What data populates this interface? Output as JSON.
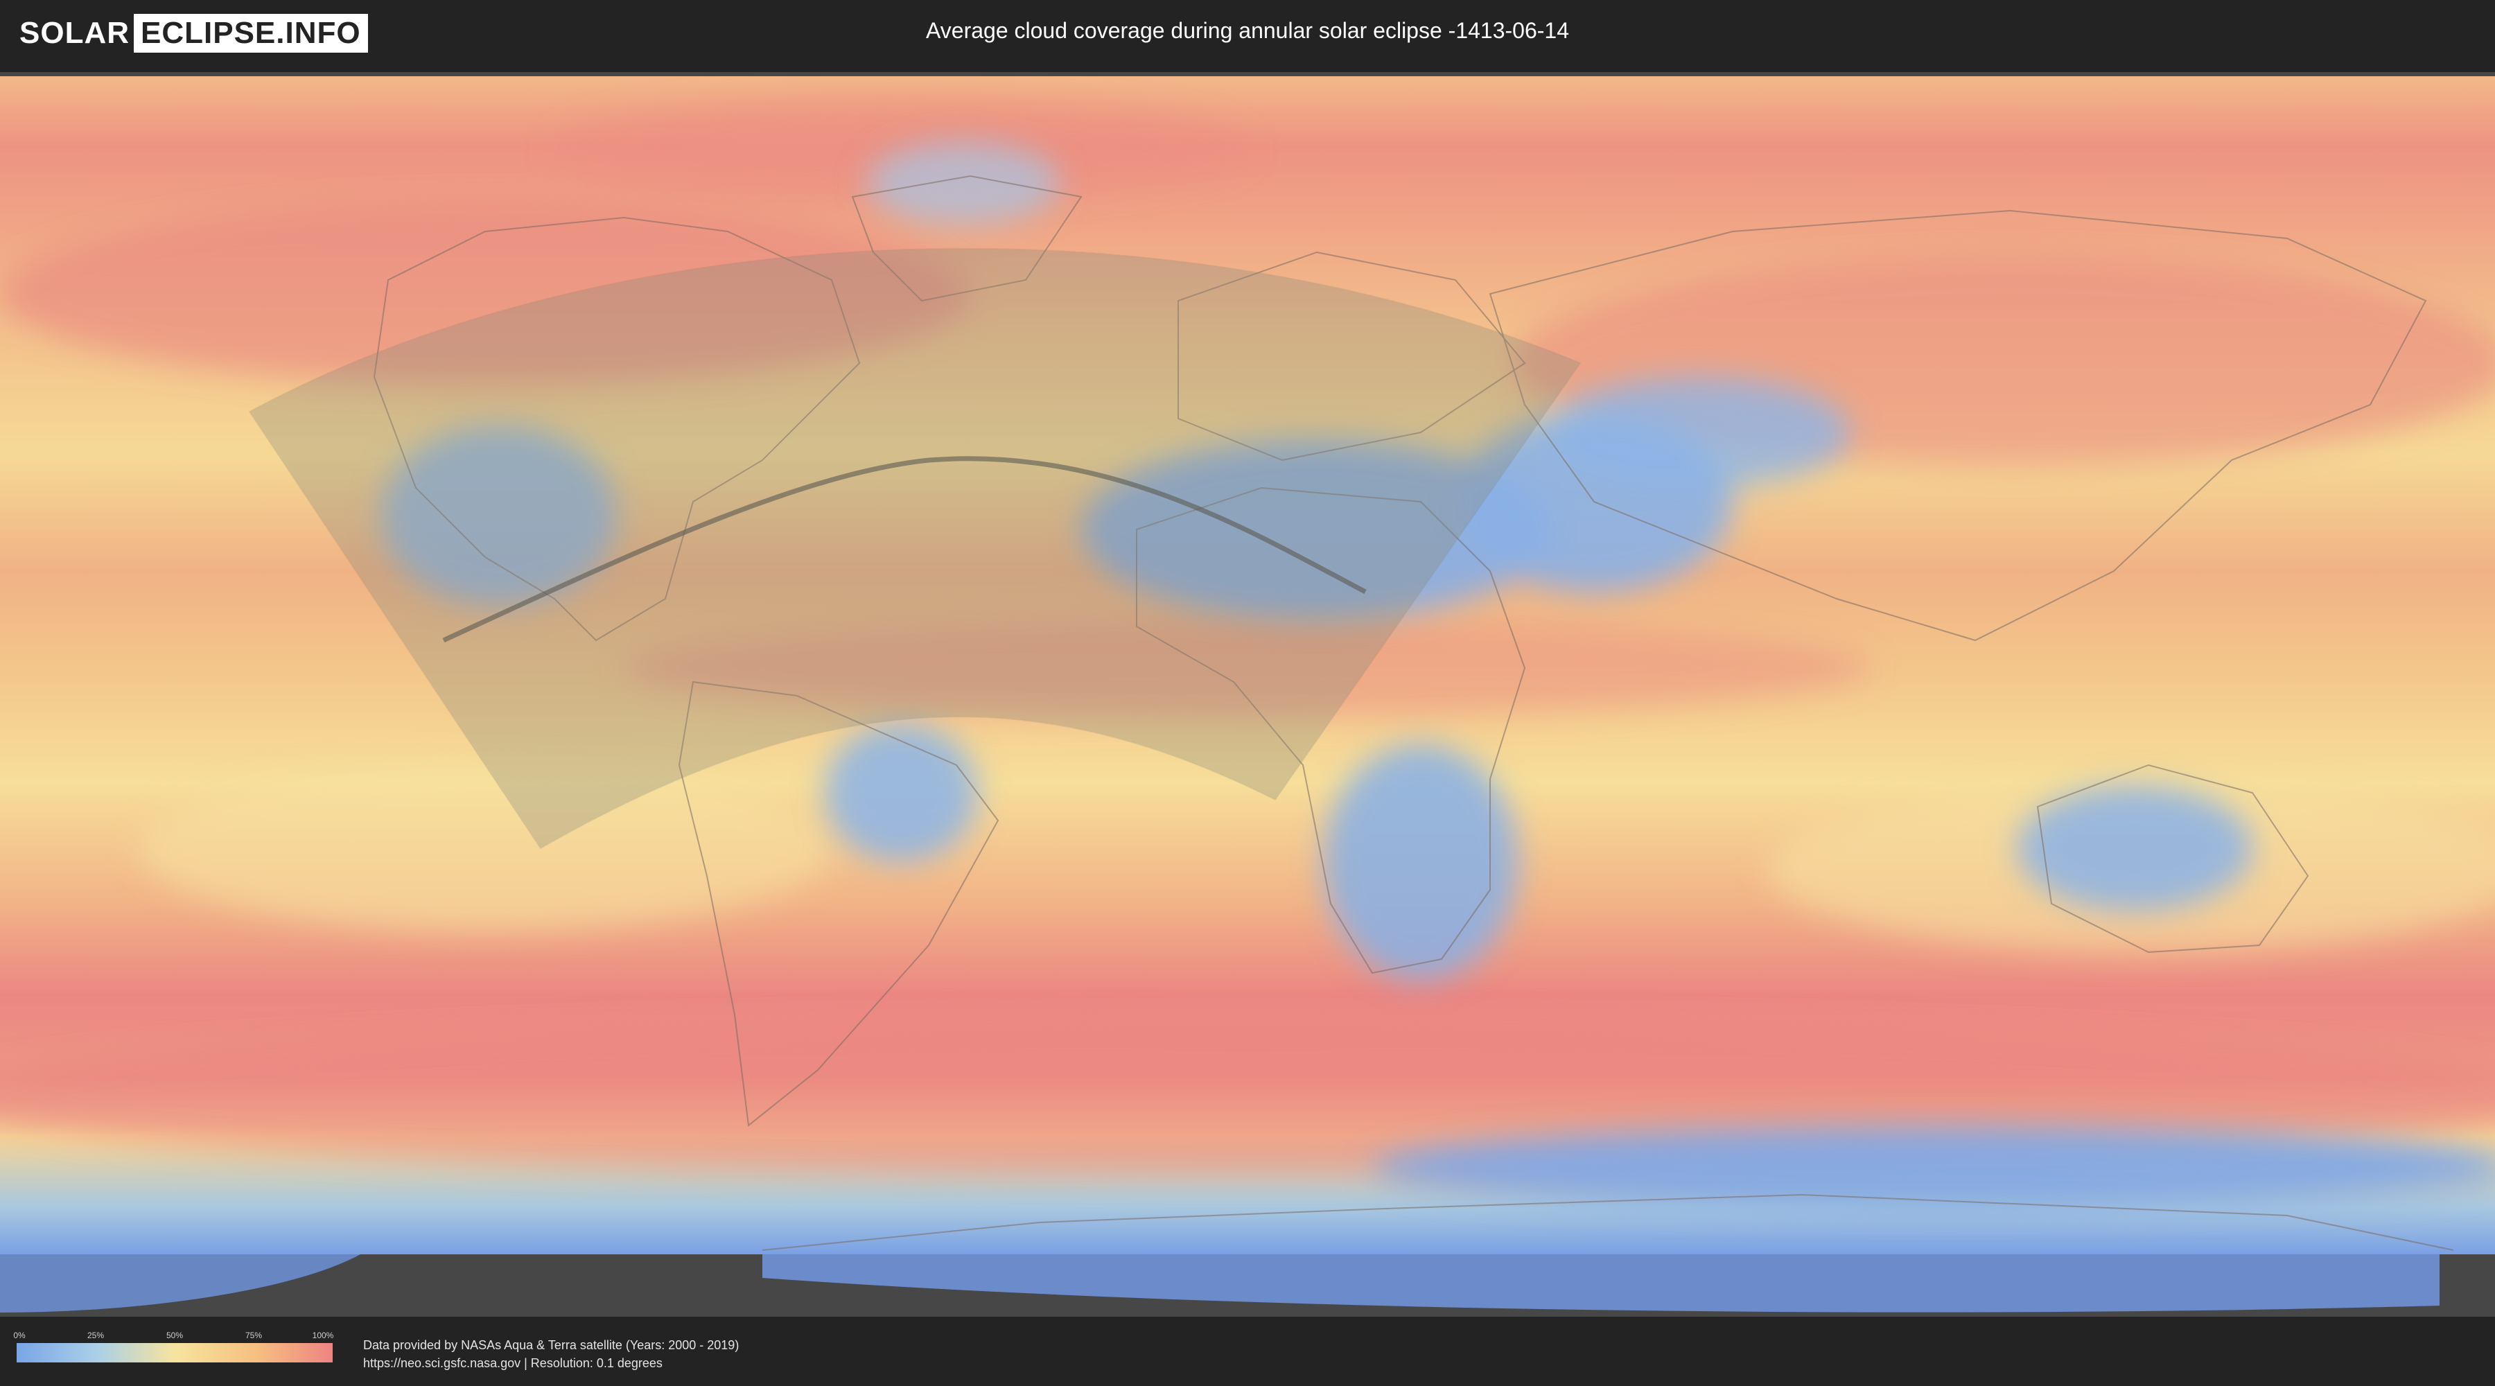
{
  "header": {
    "logo_left": "SOLAR",
    "logo_right": "ECLIPSE.INFO",
    "title": "Average cloud coverage during annular solar eclipse -1413-06-14"
  },
  "map": {
    "colors": {
      "clear": "#7aa5e6",
      "low": "#a9cfe8",
      "mid": "#f7e39f",
      "high": "#f6c182",
      "overcast": "#ee8482",
      "eclipse_zone": "#8a8a7a",
      "background": "#474747"
    }
  },
  "legend": {
    "ticks": [
      "0%",
      "25%",
      "50%",
      "75%",
      "100%"
    ]
  },
  "footer": {
    "credit_line1": "Data provided by NASAs Aqua & Terra satellite (Years: 2000 - 2019)",
    "credit_line2": "https://neo.sci.gsfc.nasa.gov | Resolution: 0.1 degrees"
  }
}
